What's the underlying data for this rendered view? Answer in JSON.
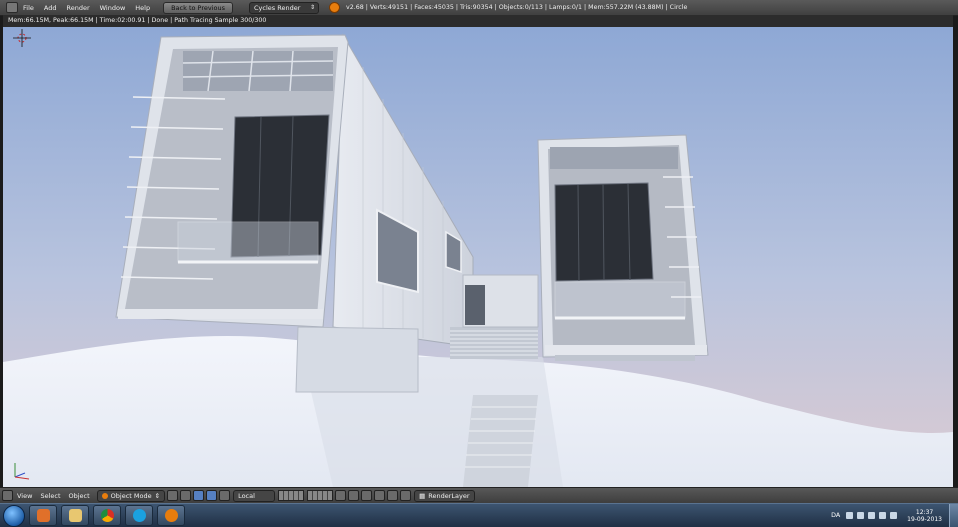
{
  "top_menu": {
    "items": [
      "File",
      "Add",
      "Render",
      "Window",
      "Help"
    ],
    "back_button": "Back to Previous",
    "render_engine": "Cycles Render",
    "stats": "v2.68 | Verts:49151 | Faces:45035 | Tris:90354 | Objects:0/113 | Lamps:0/1 | Mem:557.22M (43.88M) | Circle"
  },
  "viewport": {
    "status_text": "Mem:66.15M, Peak:66.15M | Time:02:00.91 | Done | Path Tracing Sample 300/300"
  },
  "bottom_header": {
    "items": [
      "View",
      "Select",
      "Object"
    ],
    "mode": "Object Mode",
    "pivot": "Local",
    "render_layer": "RenderLayer"
  },
  "taskbar": {
    "language": "DA",
    "time": "12:37",
    "date": "19-09-2013"
  },
  "colors": {
    "sky_top": "#8fa9d6",
    "sky_bottom": "#d9c6ce",
    "ground": "#eef2fa",
    "accent": "#e87d0d"
  }
}
